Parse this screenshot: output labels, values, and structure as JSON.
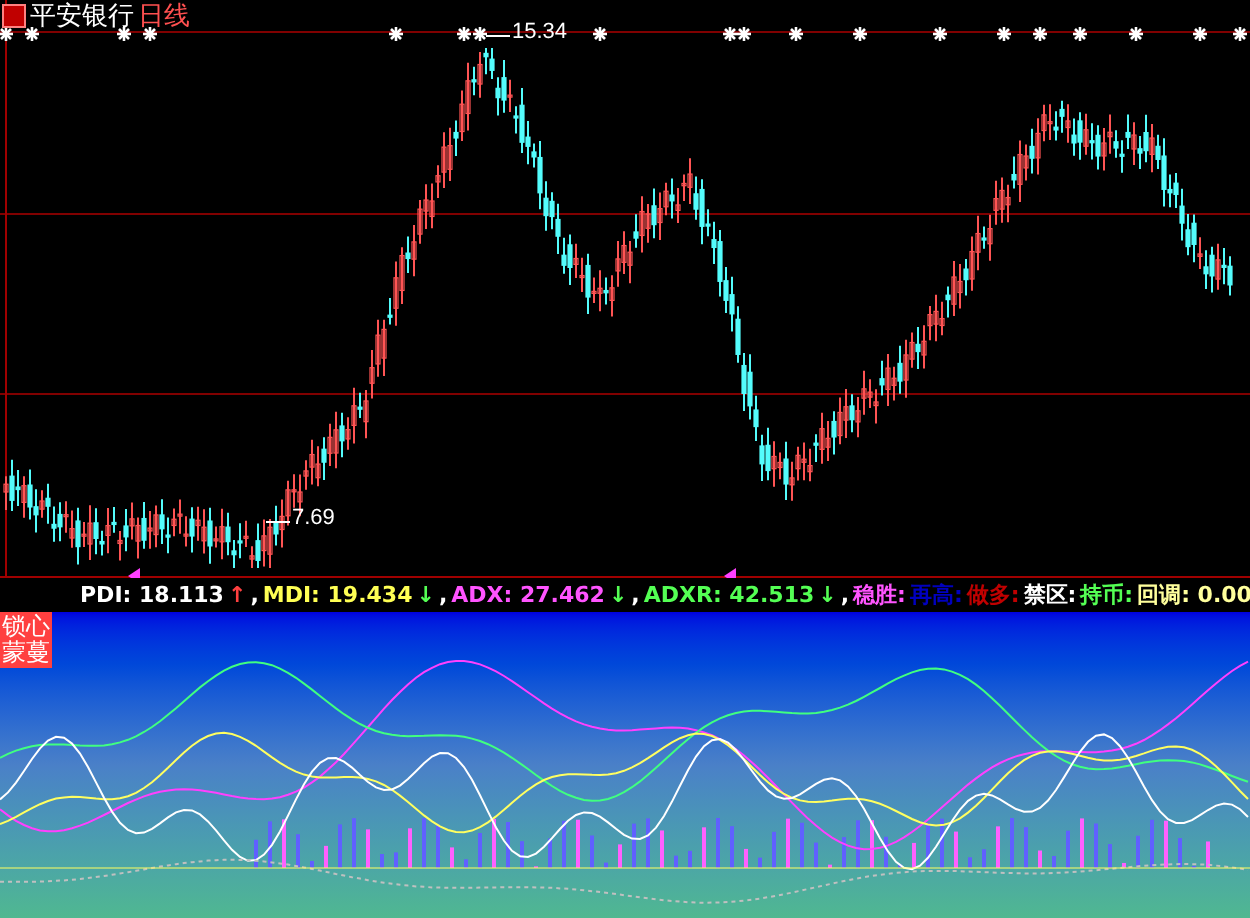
{
  "stock": {
    "name": "平安银行",
    "period": "日线"
  },
  "price_labels": [
    {
      "text": "15.34"
    },
    {
      "text": "7.69"
    }
  ],
  "indicator_header": [
    {
      "text": "PDI: 18.113",
      "color": "#ffffff"
    },
    {
      "text": "↑",
      "color": "#ff4040"
    },
    {
      "text": ",",
      "color": "#ffffff"
    },
    {
      "text": "MDI: 19.434",
      "color": "#ffff54"
    },
    {
      "text": "↓",
      "color": "#54ff54"
    },
    {
      "text": ",",
      "color": "#ffffff"
    },
    {
      "text": "ADX: 27.462",
      "color": "#ff54ff"
    },
    {
      "text": "↓",
      "color": "#54ff54"
    },
    {
      "text": ",",
      "color": "#ffffff"
    },
    {
      "text": "ADXR: 42.513",
      "color": "#54ff54"
    },
    {
      "text": "↓",
      "color": "#54ff54"
    },
    {
      "text": ",",
      "color": "#ffffff"
    },
    {
      "text": "稳胜:",
      "color": "#ff54ff"
    },
    {
      "text": "再高:",
      "color": "#0000c0"
    },
    {
      "text": "做多:",
      "color": "#c00000"
    },
    {
      "text": "禁区:",
      "color": "#ffffff"
    },
    {
      "text": "持币:",
      "color": "#54ff54"
    },
    {
      "text": "回调: 0.00",
      "color": "#ffff9c"
    }
  ],
  "signal_box": {
    "lines": [
      "锁心",
      "蒙蔓"
    ]
  }
}
